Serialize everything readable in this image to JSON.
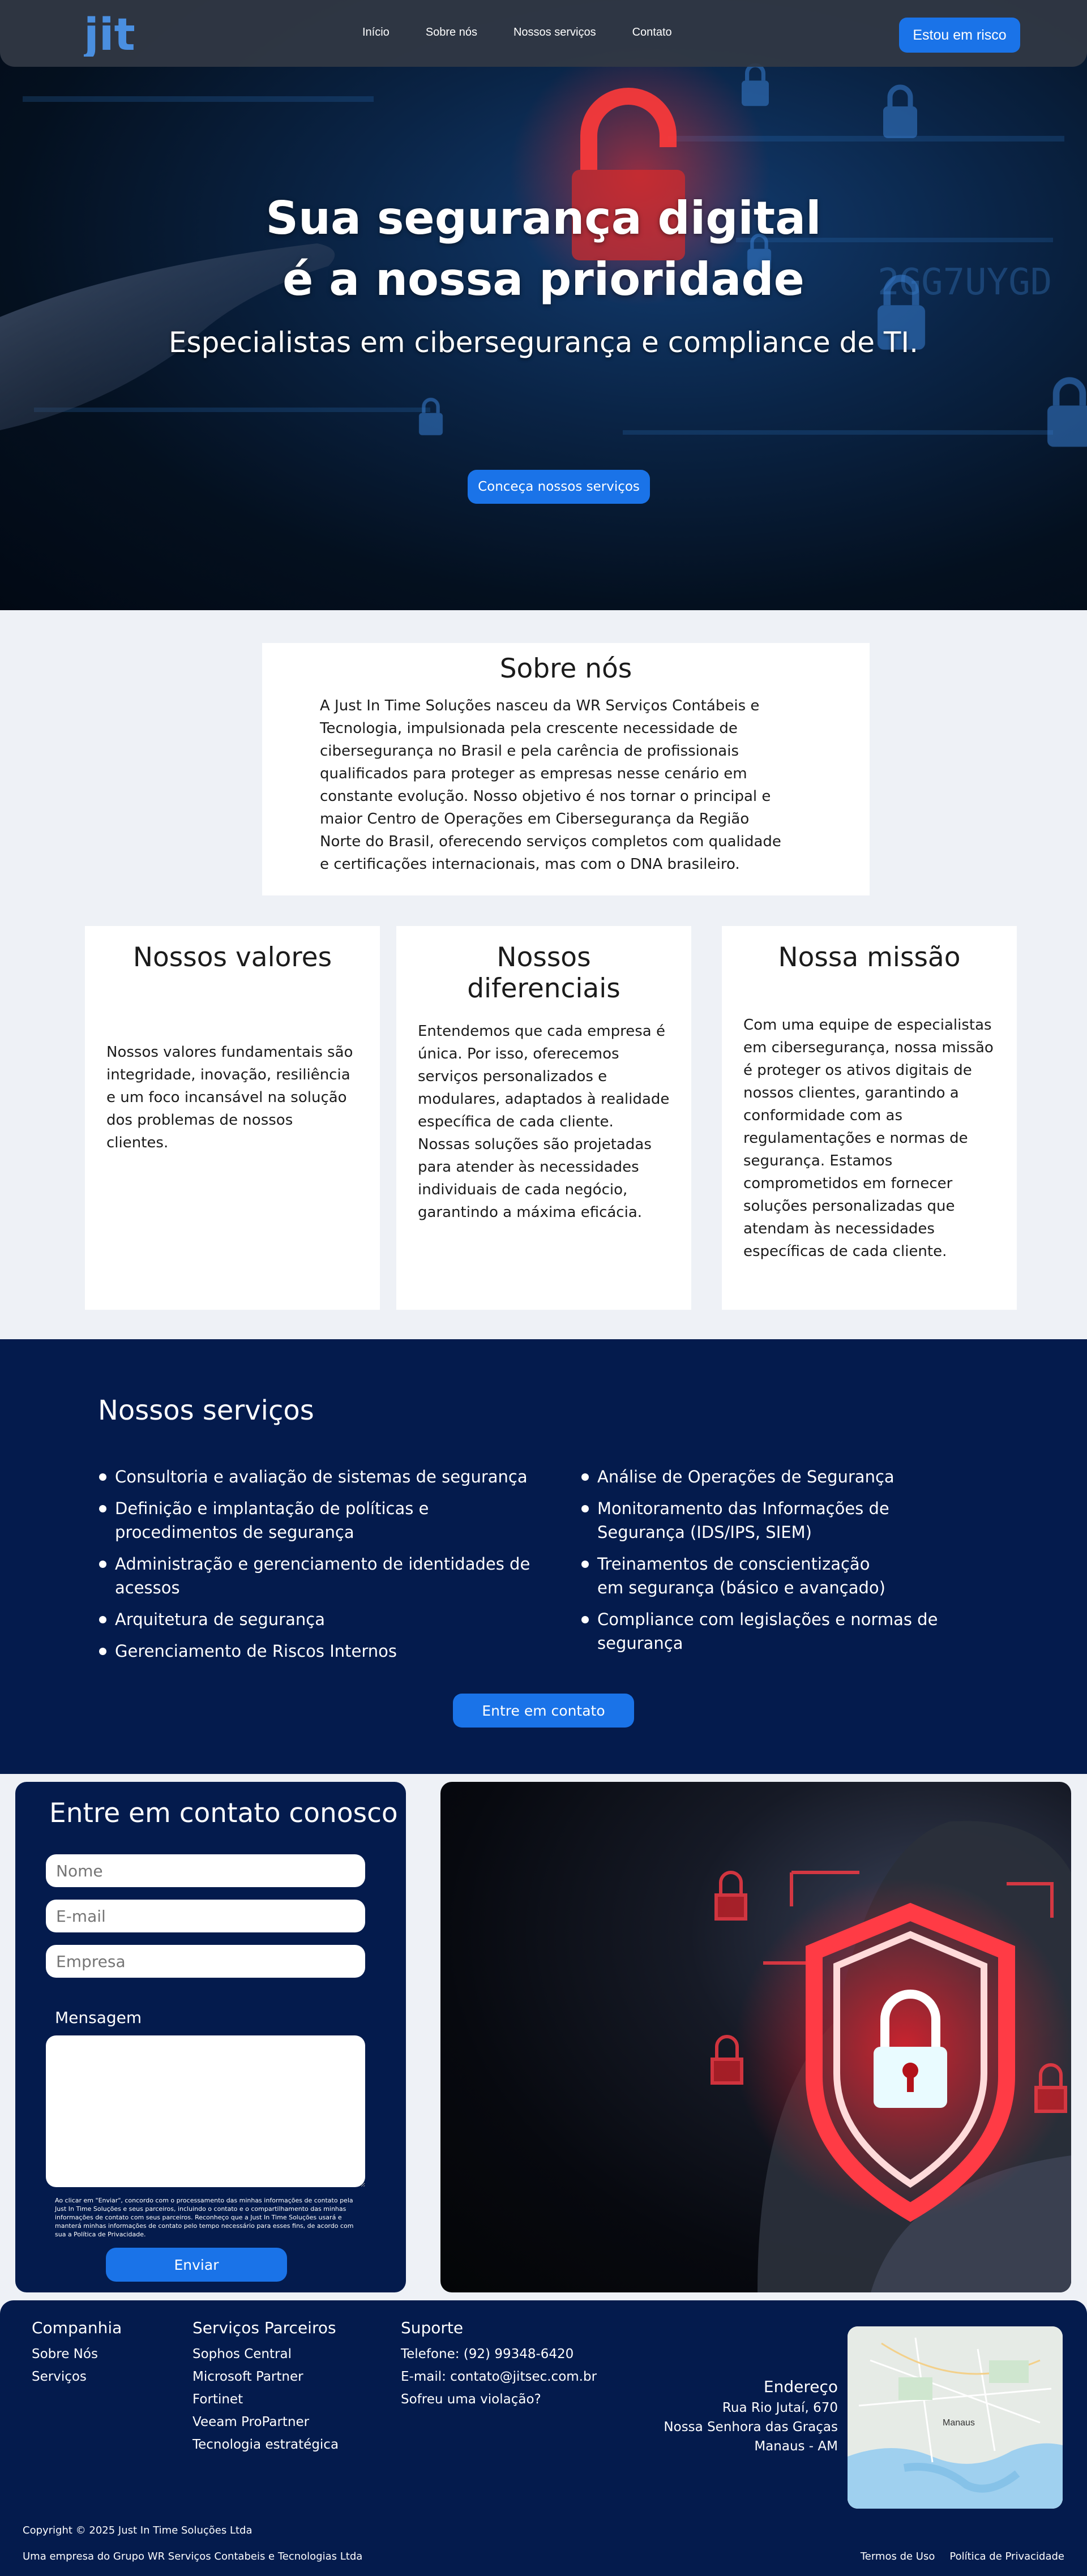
{
  "header": {
    "logo_text": "jit",
    "nav": [
      "Início",
      "Sobre nós",
      "Nossos serviços",
      "Contato"
    ],
    "risk_button": "Estou em risco"
  },
  "hero": {
    "title_line1": "Sua segurança digital",
    "title_line2": "é a nossa prioridade",
    "subtitle": "Especialistas em cibersegurança e compliance de TI.",
    "cta": "Conceça nossos serviços",
    "code_text": "2GG7UYGD"
  },
  "about": {
    "title": "Sobre nós",
    "text": "A Just In Time Soluções nasceu da WR Serviços Contábeis e Tecnologia, impulsionada pela crescente necessidade de cibersegurança no Brasil e pela carência de profissionais qualificados para proteger as empresas nesse cenário em constante evolução. Nosso objetivo é nos tornar o principal e maior Centro de Operações em Cibersegurança da Região Norte do Brasil, oferecendo serviços completos com qualidade e certificações internacionais, mas com o DNA brasileiro."
  },
  "cards": [
    {
      "title": "Nossos valores",
      "text": "Nossos valores fundamentais são integridade, inovação, resiliência e um foco incansável na solução dos problemas de nossos clientes."
    },
    {
      "title": "Nossos diferenciais",
      "text": "Entendemos que cada empresa é única. Por isso, oferecemos serviços personalizados e modulares, adaptados à realidade específica de cada cliente. Nossas soluções são projetadas para atender às necessidades individuais de cada negócio, garantindo a máxima eficácia."
    },
    {
      "title": "Nossa missão",
      "text": "Com uma equipe de especialistas em cibersegurança, nossa missão é proteger os ativos digitais de nossos clientes, garantindo a conformidade com as regulamentações e normas de segurança. Estamos comprometidos em fornecer soluções personalizadas que atendam às necessidades específicas de cada cliente."
    }
  ],
  "services": {
    "title": "Nossos serviços",
    "left": [
      "Consultoria e avaliação de sistemas de segurança",
      "Definição e implantação de políticas e procedimentos de segurança",
      "Administração e gerenciamento de identidades de acessos",
      "Arquitetura de segurança",
      "Gerenciamento de Riscos Internos"
    ],
    "right": [
      "Análise de Operações de Segurança",
      "Monitoramento das Informações de Segurança (IDS/IPS, SIEM)",
      "Treinamentos de conscientização em segurança (básico e avançado)",
      "Compliance com legislações e normas de segurança"
    ],
    "cta": "Entre em contato"
  },
  "contact": {
    "title": "Entre em contato conosco",
    "name_placeholder": "Nome",
    "email_placeholder": "E-mail",
    "company_placeholder": "Empresa",
    "message_label": "Mensagem",
    "consent": "Ao clicar em \"Enviar\", concordo com o processamento das minhas informações de contato pela Just In Time Soluções e seus parceiros, incluindo o contato e o compartilhamento das minhas informações de contato com seus parceiros. Reconheço que a Just In Time Soluções usará e manterá minhas informações de contato pelo tempo necessário para esses fins, de acordo com sua a Política de Privacidade.",
    "submit": "Enviar"
  },
  "footer": {
    "company_title": "Companhia",
    "company_links": [
      "Sobre Nós",
      "Serviços"
    ],
    "partners_title": "Serviços Parceiros",
    "partners": [
      "Sophos Central",
      "Microsoft Partner",
      "Fortinet",
      "Veeam ProPartner",
      "Tecnologia estratégica"
    ],
    "support_title": "Suporte",
    "support": [
      "Telefone: (92) 99348-6420",
      "E-mail: contato@jitsec.com.br",
      "Sofreu uma violação?"
    ],
    "address_title": "Endereço",
    "address": [
      "Rua Rio Jutaí, 670",
      "Nossa Senhora das Graças",
      "Manaus - AM"
    ],
    "map_label": "Manaus",
    "copyright": "Copyright © 2025 Just In Time Soluções Ltda",
    "group": "Uma empresa do Grupo WR Serviços Contabeis e Tecnologias Ltda",
    "terms": "Termos de Uso",
    "privacy": "Política de Privacidade"
  },
  "colors": {
    "accent": "#1a73e8",
    "navy": "#041b4d",
    "background": "#eef1f6"
  }
}
